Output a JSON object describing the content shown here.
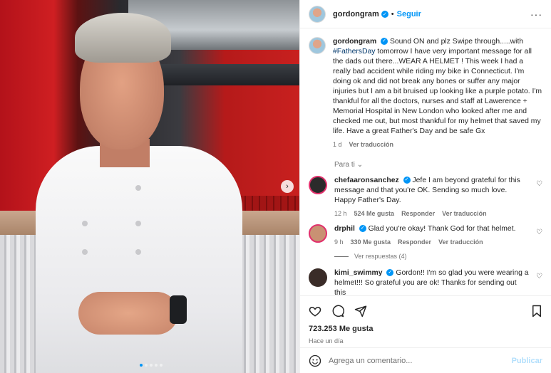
{
  "post": {
    "username": "gordongram",
    "follow_label": "Seguir",
    "separator": "•",
    "more_icon": "more-horizontal-icon",
    "caption_text": "Sound ON and plz Swipe through.....with",
    "caption_hashtag": "#FathersDay",
    "caption_rest": " tomorrow I have very important message for all the dads out there...WEAR A HELMET ! This week I had a really bad accident while riding my bike in Connecticut. I'm doing ok and did not break any bones or suffer any major injuries but I am a bit bruised up looking like a purple potato. I'm thankful for all the doctors, nurses and staff at Lawerence + Memorial Hospital in New London who looked after me and checked me out, but most thankful for my helmet that saved my life. Have a great Father's Day and be safe Gx",
    "caption_time": "1 d",
    "caption_translate": "Ver traducción",
    "for_you_label": "Para ti"
  },
  "comments": [
    {
      "username": "chefaaronsanchez",
      "text": "Jefe I am beyond grateful for this message and that you're OK. Sending so much love. Happy Father's Day.",
      "time": "12 h",
      "likes": "524 Me gusta",
      "reply_label": "Responder",
      "translate_label": "Ver traducción",
      "avatar_color": "#2b2b2b"
    },
    {
      "username": "drphil",
      "text": "Glad you're okay! Thank God for that helmet.",
      "time": "9 h",
      "likes": "330 Me gusta",
      "reply_label": "Responder",
      "translate_label": "Ver traducción",
      "avatar_color": "#c99173",
      "view_replies": "Ver respuestas (4)"
    },
    {
      "username": "kimi_swimmy",
      "text": "Gordon!! I'm so glad you were wearing a helmet!!! So grateful you are ok! Thanks for sending out this",
      "avatar_color": "#3a2c28"
    }
  ],
  "actions": {
    "like_icon": "heart-icon",
    "comment_icon": "comment-icon",
    "share_icon": "send-icon",
    "save_icon": "bookmark-icon",
    "likes_count": "723.253 Me gusta",
    "time_ago": "Hace un día"
  },
  "add_comment": {
    "emoji_icon": "emoji-icon",
    "placeholder": "Agrega un comentario...",
    "publish_label": "Publicar"
  },
  "media": {
    "next_icon": "chevron-right-icon",
    "carousel_total": 5,
    "carousel_active": 1
  },
  "colors": {
    "accent": "#0095f6",
    "text": "#262626",
    "muted": "#737373"
  }
}
